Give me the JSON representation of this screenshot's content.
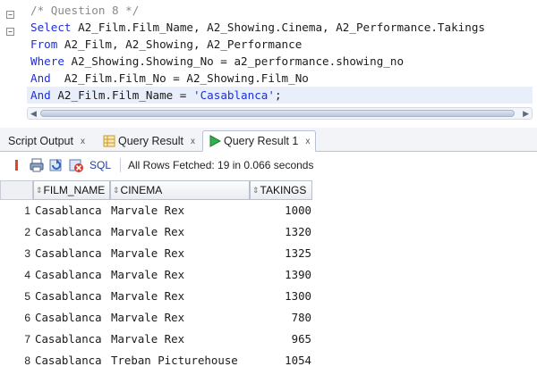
{
  "editor": {
    "lines": [
      {
        "parts": [
          {
            "t": "/* Question 8 */",
            "c": "cm"
          }
        ]
      },
      {
        "parts": [
          {
            "t": "Select",
            "c": "kw"
          },
          {
            "t": " A2_Film.Film_Name, A2_Showing.Cinema, A2_Performance.Takings",
            "c": ""
          }
        ]
      },
      {
        "parts": [
          {
            "t": "From",
            "c": "kw"
          },
          {
            "t": " A2_Film, A2_Showing, A2_Performance",
            "c": ""
          }
        ]
      },
      {
        "parts": [
          {
            "t": "Where",
            "c": "kw"
          },
          {
            "t": " A2_Showing.Showing_No = a2_performance.showing_no",
            "c": ""
          }
        ]
      },
      {
        "parts": [
          {
            "t": "And",
            "c": "kw"
          },
          {
            "t": "  A2_Film.Film_No = A2_Showing.Film_No",
            "c": ""
          }
        ]
      },
      {
        "parts": [
          {
            "t": "And",
            "c": "kw"
          },
          {
            "t": " A2_Film.Film_Name = ",
            "c": ""
          },
          {
            "t": "'Casablanca'",
            "c": "str"
          },
          {
            "t": ";",
            "c": ""
          }
        ]
      }
    ]
  },
  "tabs": [
    {
      "label": "Script Output",
      "close": "x",
      "active": false
    },
    {
      "label": "Query Result",
      "close": "x",
      "active": false
    },
    {
      "label": "Query Result 1",
      "close": "x",
      "active": true
    }
  ],
  "toolbar": {
    "sql_label": "SQL",
    "status": "All Rows Fetched: 19 in 0.066 seconds"
  },
  "grid": {
    "columns": [
      "FILM_NAME",
      "CINEMA",
      "TAKINGS"
    ],
    "rows": [
      {
        "n": "1",
        "film": "Casablanca",
        "cinema": "Marvale Rex",
        "takings": "1000"
      },
      {
        "n": "2",
        "film": "Casablanca",
        "cinema": "Marvale Rex",
        "takings": "1320"
      },
      {
        "n": "3",
        "film": "Casablanca",
        "cinema": "Marvale Rex",
        "takings": "1325"
      },
      {
        "n": "4",
        "film": "Casablanca",
        "cinema": "Marvale Rex",
        "takings": "1390"
      },
      {
        "n": "5",
        "film": "Casablanca",
        "cinema": "Marvale Rex",
        "takings": "1300"
      },
      {
        "n": "6",
        "film": "Casablanca",
        "cinema": "Marvale Rex",
        "takings": "780"
      },
      {
        "n": "7",
        "film": "Casablanca",
        "cinema": "Marvale Rex",
        "takings": "965"
      },
      {
        "n": "8",
        "film": "Casablanca",
        "cinema": "Treban Picturehouse",
        "takings": "1054"
      }
    ]
  }
}
